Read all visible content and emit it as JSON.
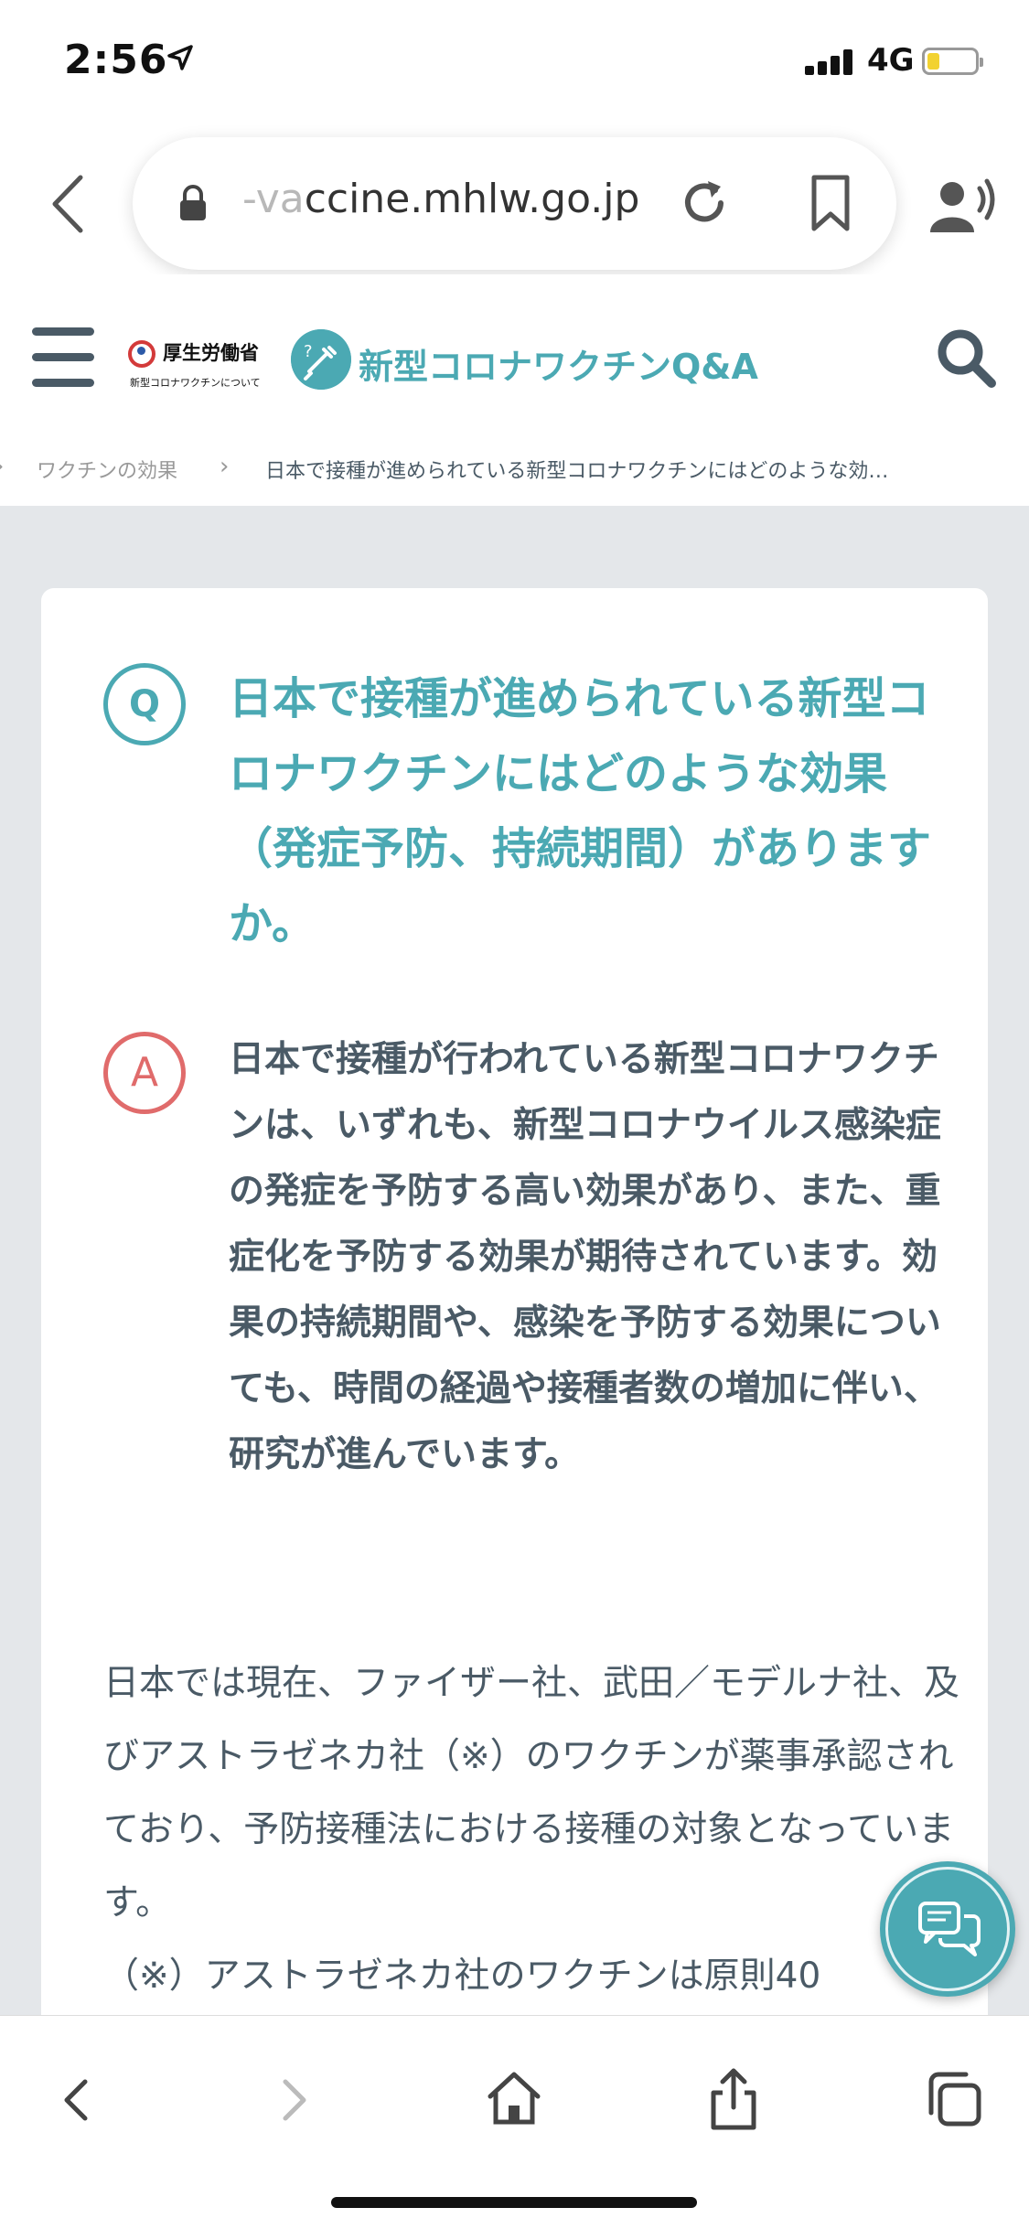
{
  "status_bar": {
    "time": "2:56",
    "network": "4G",
    "battery_level": 0.25
  },
  "browser": {
    "url_faded": "-va",
    "url_main": "ccine.mhlw.go.jp"
  },
  "header": {
    "mhlw_name": "厚生労働省",
    "mhlw_sub": "新型コロナワクチンについて",
    "qa_title": "新型コロナワクチンQ&A"
  },
  "breadcrumb": {
    "items": [
      "ワクチンの効果",
      "日本で接種が進められている新型コロナワクチンにはどのような効…"
    ]
  },
  "question": {
    "badge": "Q",
    "text": "日本で接種が進められている新型コロナワクチンにはどのような効果（発症予防、持続期間）がありますか。"
  },
  "answer": {
    "badge": "A",
    "text": "日本で接種が行われている新型コロナワクチンは、いずれも、新型コロナウイルス感染症の発症を予防する高い効果があり、また、重症化を予防する効果が期待されています。効果の持続期間や、感染を予防する効果についても、時間の経過や接種者数の増加に伴い、研究が進んでいます。"
  },
  "body": {
    "paragraph": "日本では現在、ファイザー社、武田／モデルナ社、及びアストラゼネカ社（※）のワクチンが薬事承認されており、予防接種法における接種の対象となっています。",
    "note": "（※）アストラゼネカ社のワクチンは原則40"
  },
  "colors": {
    "accent": "#4ba9b3",
    "answer_accent": "#e06b6b",
    "text": "#4a5a66",
    "background": "#e4e7ea"
  },
  "icons": [
    "back-icon",
    "lock-icon",
    "reload-icon",
    "bookmark-icon",
    "speaker-icon",
    "menu-icon",
    "search-icon",
    "chat-icon",
    "forward-icon",
    "home-icon",
    "share-icon",
    "tabs-icon"
  ]
}
